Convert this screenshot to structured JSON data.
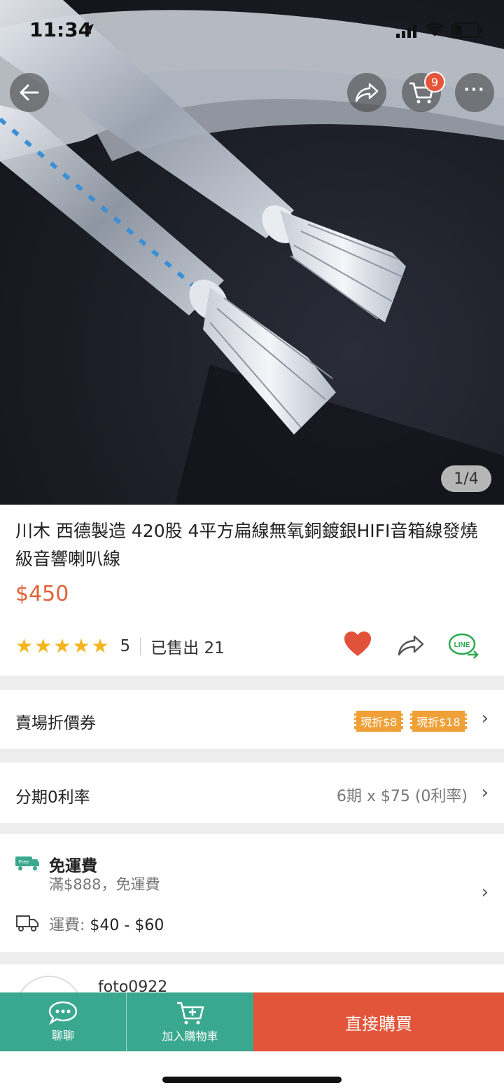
{
  "status_bar": {
    "time": "11:34"
  },
  "gallery": {
    "counter": "1/4"
  },
  "nav": {
    "cart_count": "9"
  },
  "product": {
    "title": "川木  西德製造 420股 4平方扁線無氧銅鍍銀HIFI音箱線發燒級音響喇叭線",
    "price": "$450",
    "rating": 5,
    "rating_text": "5",
    "sold_text": "已售出 21"
  },
  "coupons": {
    "label": "賣場折價券",
    "items": [
      "現折$8",
      "現折$18"
    ]
  },
  "installment": {
    "label": "分期0利率",
    "value": "6期 x $75 (0利率)"
  },
  "shipping": {
    "free_title": "免運費",
    "free_sub": "滿$888，免運費",
    "fee_label": "運費:",
    "fee_value": "$40 - $60"
  },
  "seller": {
    "name": "foto0922"
  },
  "bottom_bar": {
    "chat_label": "聊聊",
    "cart_label": "加入購物車",
    "buy_label": "直接購買"
  },
  "colors": {
    "accent": "#e0623a",
    "green": "#3aa88f",
    "buy": "#e2553a",
    "star": "#f6b51e"
  }
}
